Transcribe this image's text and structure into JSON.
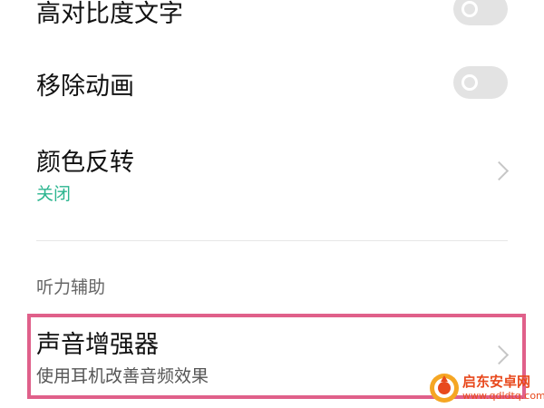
{
  "settings": {
    "high_contrast": {
      "label": "高对比度文字",
      "enabled": false
    },
    "remove_animation": {
      "label": "移除动画",
      "enabled": false
    },
    "color_inversion": {
      "title": "颜色反转",
      "status": "关闭",
      "status_color": "#2bb58f"
    },
    "hearing_section": {
      "header": "听力辅助"
    },
    "sound_enhancer": {
      "title": "声音增强器",
      "subtitle": "使用耳机改善音频效果"
    }
  },
  "highlight": {
    "color": "#e0608a"
  },
  "watermark": {
    "name": "启东安卓网",
    "url": "www.qdldtq.com",
    "color": "#e8491d"
  },
  "colors": {
    "toggle_off": "#e3e3e3",
    "chevron": "#c6c6c6",
    "divider": "#e6e6e6"
  }
}
